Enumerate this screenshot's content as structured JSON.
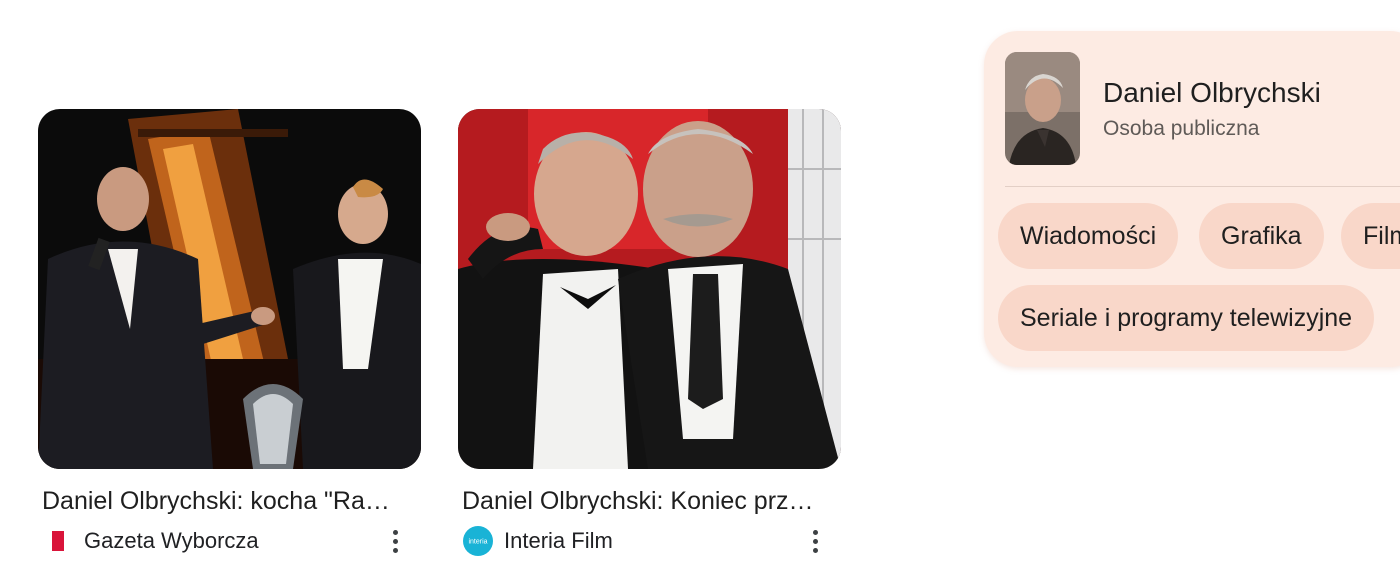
{
  "results": [
    {
      "title": "Daniel Olbrychski: kocha \"Ra…",
      "source": "Gazeta Wyborcza",
      "source_icon": "gazeta-wyborcza-logo",
      "image": "two-men-on-stage-photo"
    },
    {
      "title": "Daniel Olbrychski: Koniec prz…",
      "source": "Interia Film",
      "source_icon": "interia-film-logo",
      "source_icon_text": "interia",
      "image": "two-men-embracing-photo"
    }
  ],
  "knowledge_panel": {
    "name": "Daniel Olbrychski",
    "subtitle": "Osoba publiczna",
    "chips": [
      "Wiadomości",
      "Grafika",
      "Film",
      "Seriale i programy telewizyjne"
    ]
  },
  "colors": {
    "panel_bg": "#fdebe3",
    "chip_bg": "#f9d7c9",
    "gazeta_red": "#d9143a",
    "interia_blue": "#19b3d6"
  }
}
